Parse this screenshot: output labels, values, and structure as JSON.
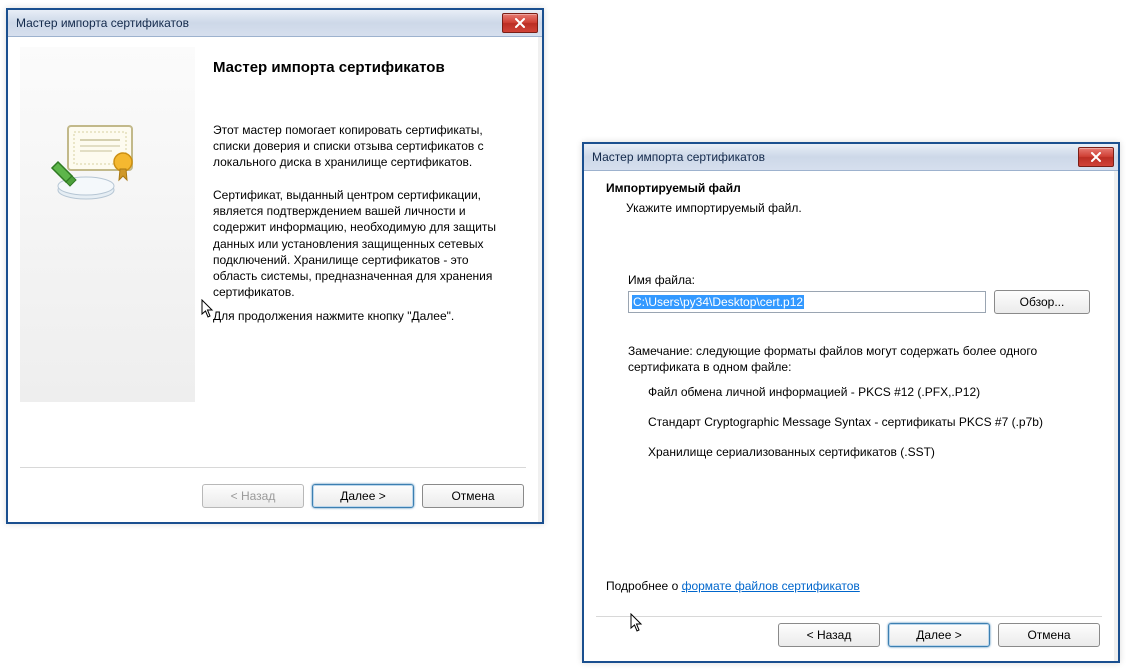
{
  "dialog1": {
    "title": "Мастер импорта сертификатов",
    "heading": "Мастер импорта сертификатов",
    "para1": "Этот мастер помогает копировать сертификаты, списки доверия и списки отзыва сертификатов с локального диска в хранилище сертификатов.",
    "para2": "Сертификат, выданный центром сертификации, является подтверждением вашей личности и содержит информацию, необходимую для защиты данных или установления защищенных сетевых подключений. Хранилище сертификатов - это область системы, предназначенная для хранения сертификатов.",
    "para3": "Для продолжения нажмите кнопку \"Далее\".",
    "buttons": {
      "back": "< Назад",
      "next": "Далее >",
      "cancel": "Отмена"
    }
  },
  "dialog2": {
    "title": "Мастер импорта сертификатов",
    "header_title": "Импортируемый файл",
    "header_sub": "Укажите импортируемый файл.",
    "file_label": "Имя файла:",
    "file_value": "C:\\Users\\py34\\Desktop\\cert.p12",
    "browse": "Обзор...",
    "note": "Замечание: следующие форматы файлов могут содержать более одного сертификата в одном файле:",
    "formats": [
      "Файл обмена личной информацией - PKCS #12 (.PFX,.P12)",
      "Стандарт Cryptographic Message Syntax - сертификаты PKCS #7 (.p7b)",
      "Хранилище сериализованных сертификатов (.SST)"
    ],
    "more_prefix": "Подробнее о ",
    "more_link": "формате файлов сертификатов",
    "buttons": {
      "back": "< Назад",
      "next": "Далее >",
      "cancel": "Отмена"
    }
  }
}
